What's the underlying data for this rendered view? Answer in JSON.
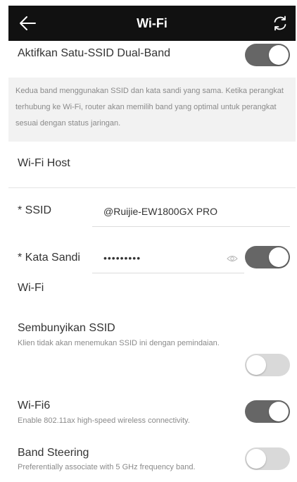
{
  "header": {
    "title": "Wi-Fi",
    "back_icon": "arrow-left-icon",
    "refresh_icon": "refresh-icon"
  },
  "dual_band": {
    "label": "Aktifkan Satu-SSID Dual-Band",
    "enabled": true,
    "description": "Kedua band menggunakan SSID dan kata sandi yang sama. Ketika perangkat terhubung ke Wi-Fi, router akan memilih band yang optimal untuk perangkat sesuai dengan status jaringan."
  },
  "section_title": "Wi-Fi Host",
  "ssid": {
    "label": "* SSID",
    "value": "@Ruijie-EW1800GX PRO"
  },
  "password": {
    "label": "* Kata Sandi",
    "value": "•••••••••",
    "wifi_label": "Wi-Fi",
    "enabled": true,
    "eye_icon": "eye-icon"
  },
  "hide_ssid": {
    "label": "Sembunyikan SSID",
    "description": "Klien tidak akan menemukan SSID ini dengan pemindaian.",
    "enabled": false
  },
  "wifi6": {
    "label": "Wi-Fi6",
    "description": "Enable 802.11ax high-speed wireless connectivity.",
    "enabled": true
  },
  "band_steering": {
    "label": "Band Steering",
    "description": "Preferentially associate with 5 GHz frequency band.",
    "enabled": false
  },
  "colors": {
    "header_bg": "#111111",
    "toggle_on": "#666666",
    "toggle_off": "#d9d9d9",
    "info_bg": "#f2f2f2"
  }
}
